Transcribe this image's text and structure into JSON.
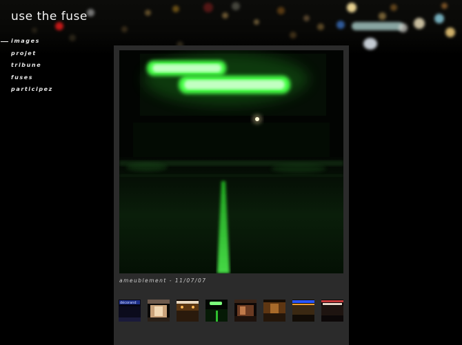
{
  "site": {
    "title": "use the fuse"
  },
  "nav": {
    "items": [
      {
        "label": "images",
        "active": true
      },
      {
        "label": "projet",
        "active": false
      },
      {
        "label": "tribune",
        "active": false
      },
      {
        "label": "fuses",
        "active": false
      },
      {
        "label": "participez",
        "active": false
      }
    ]
  },
  "gallery": {
    "main_image": "green neon sign at night (blurred)",
    "caption": "ameublement - 11/07/07",
    "thumbnails": [
      {
        "name": "thumb-1",
        "sign_text": "décorand",
        "accent": "#3a5cff"
      },
      {
        "name": "thumb-2",
        "accent": "#c9a27a"
      },
      {
        "name": "thumb-3",
        "accent": "#c98a3a"
      },
      {
        "name": "thumb-4",
        "accent": "#36ff36"
      },
      {
        "name": "thumb-5",
        "accent": "#b06a3a"
      },
      {
        "name": "thumb-6",
        "accent": "#a86a2a"
      },
      {
        "name": "thumb-7",
        "accent": "#2a56ff"
      },
      {
        "name": "thumb-8",
        "accent": "#c83a3a"
      }
    ]
  },
  "colors": {
    "background": "#000000",
    "panel": "#2b2b2b",
    "neon": "#33ff33",
    "text": "#ffffff"
  }
}
